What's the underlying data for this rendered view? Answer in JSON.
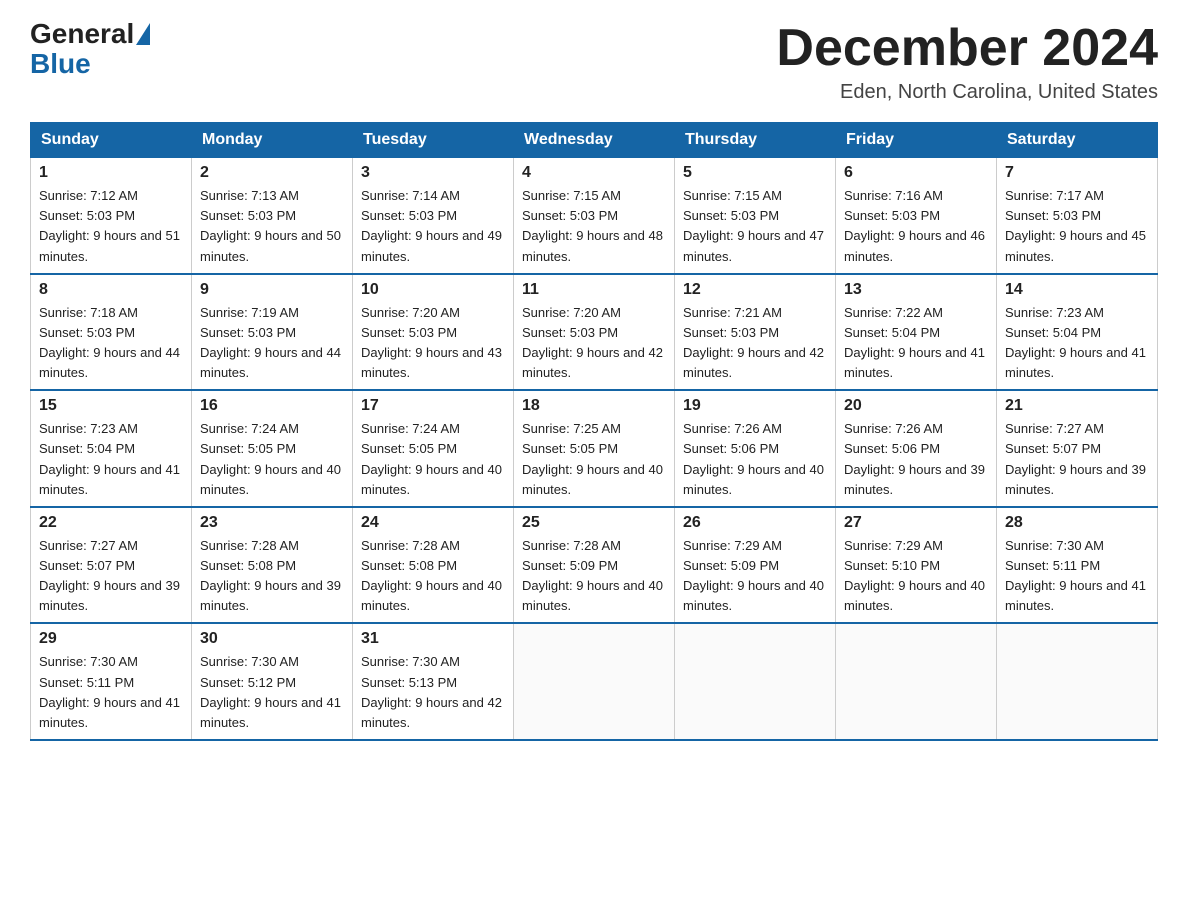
{
  "header": {
    "logo_general": "General",
    "logo_blue": "Blue",
    "month_title": "December 2024",
    "location": "Eden, North Carolina, United States"
  },
  "weekdays": [
    "Sunday",
    "Monday",
    "Tuesday",
    "Wednesday",
    "Thursday",
    "Friday",
    "Saturday"
  ],
  "weeks": [
    [
      {
        "day": 1,
        "sunrise": "7:12 AM",
        "sunset": "5:03 PM",
        "daylight": "9 hours and 51 minutes"
      },
      {
        "day": 2,
        "sunrise": "7:13 AM",
        "sunset": "5:03 PM",
        "daylight": "9 hours and 50 minutes"
      },
      {
        "day": 3,
        "sunrise": "7:14 AM",
        "sunset": "5:03 PM",
        "daylight": "9 hours and 49 minutes"
      },
      {
        "day": 4,
        "sunrise": "7:15 AM",
        "sunset": "5:03 PM",
        "daylight": "9 hours and 48 minutes"
      },
      {
        "day": 5,
        "sunrise": "7:15 AM",
        "sunset": "5:03 PM",
        "daylight": "9 hours and 47 minutes"
      },
      {
        "day": 6,
        "sunrise": "7:16 AM",
        "sunset": "5:03 PM",
        "daylight": "9 hours and 46 minutes"
      },
      {
        "day": 7,
        "sunrise": "7:17 AM",
        "sunset": "5:03 PM",
        "daylight": "9 hours and 45 minutes"
      }
    ],
    [
      {
        "day": 8,
        "sunrise": "7:18 AM",
        "sunset": "5:03 PM",
        "daylight": "9 hours and 44 minutes"
      },
      {
        "day": 9,
        "sunrise": "7:19 AM",
        "sunset": "5:03 PM",
        "daylight": "9 hours and 44 minutes"
      },
      {
        "day": 10,
        "sunrise": "7:20 AM",
        "sunset": "5:03 PM",
        "daylight": "9 hours and 43 minutes"
      },
      {
        "day": 11,
        "sunrise": "7:20 AM",
        "sunset": "5:03 PM",
        "daylight": "9 hours and 42 minutes"
      },
      {
        "day": 12,
        "sunrise": "7:21 AM",
        "sunset": "5:03 PM",
        "daylight": "9 hours and 42 minutes"
      },
      {
        "day": 13,
        "sunrise": "7:22 AM",
        "sunset": "5:04 PM",
        "daylight": "9 hours and 41 minutes"
      },
      {
        "day": 14,
        "sunrise": "7:23 AM",
        "sunset": "5:04 PM",
        "daylight": "9 hours and 41 minutes"
      }
    ],
    [
      {
        "day": 15,
        "sunrise": "7:23 AM",
        "sunset": "5:04 PM",
        "daylight": "9 hours and 41 minutes"
      },
      {
        "day": 16,
        "sunrise": "7:24 AM",
        "sunset": "5:05 PM",
        "daylight": "9 hours and 40 minutes"
      },
      {
        "day": 17,
        "sunrise": "7:24 AM",
        "sunset": "5:05 PM",
        "daylight": "9 hours and 40 minutes"
      },
      {
        "day": 18,
        "sunrise": "7:25 AM",
        "sunset": "5:05 PM",
        "daylight": "9 hours and 40 minutes"
      },
      {
        "day": 19,
        "sunrise": "7:26 AM",
        "sunset": "5:06 PM",
        "daylight": "9 hours and 40 minutes"
      },
      {
        "day": 20,
        "sunrise": "7:26 AM",
        "sunset": "5:06 PM",
        "daylight": "9 hours and 39 minutes"
      },
      {
        "day": 21,
        "sunrise": "7:27 AM",
        "sunset": "5:07 PM",
        "daylight": "9 hours and 39 minutes"
      }
    ],
    [
      {
        "day": 22,
        "sunrise": "7:27 AM",
        "sunset": "5:07 PM",
        "daylight": "9 hours and 39 minutes"
      },
      {
        "day": 23,
        "sunrise": "7:28 AM",
        "sunset": "5:08 PM",
        "daylight": "9 hours and 39 minutes"
      },
      {
        "day": 24,
        "sunrise": "7:28 AM",
        "sunset": "5:08 PM",
        "daylight": "9 hours and 40 minutes"
      },
      {
        "day": 25,
        "sunrise": "7:28 AM",
        "sunset": "5:09 PM",
        "daylight": "9 hours and 40 minutes"
      },
      {
        "day": 26,
        "sunrise": "7:29 AM",
        "sunset": "5:09 PM",
        "daylight": "9 hours and 40 minutes"
      },
      {
        "day": 27,
        "sunrise": "7:29 AM",
        "sunset": "5:10 PM",
        "daylight": "9 hours and 40 minutes"
      },
      {
        "day": 28,
        "sunrise": "7:30 AM",
        "sunset": "5:11 PM",
        "daylight": "9 hours and 41 minutes"
      }
    ],
    [
      {
        "day": 29,
        "sunrise": "7:30 AM",
        "sunset": "5:11 PM",
        "daylight": "9 hours and 41 minutes"
      },
      {
        "day": 30,
        "sunrise": "7:30 AM",
        "sunset": "5:12 PM",
        "daylight": "9 hours and 41 minutes"
      },
      {
        "day": 31,
        "sunrise": "7:30 AM",
        "sunset": "5:13 PM",
        "daylight": "9 hours and 42 minutes"
      },
      null,
      null,
      null,
      null
    ]
  ]
}
